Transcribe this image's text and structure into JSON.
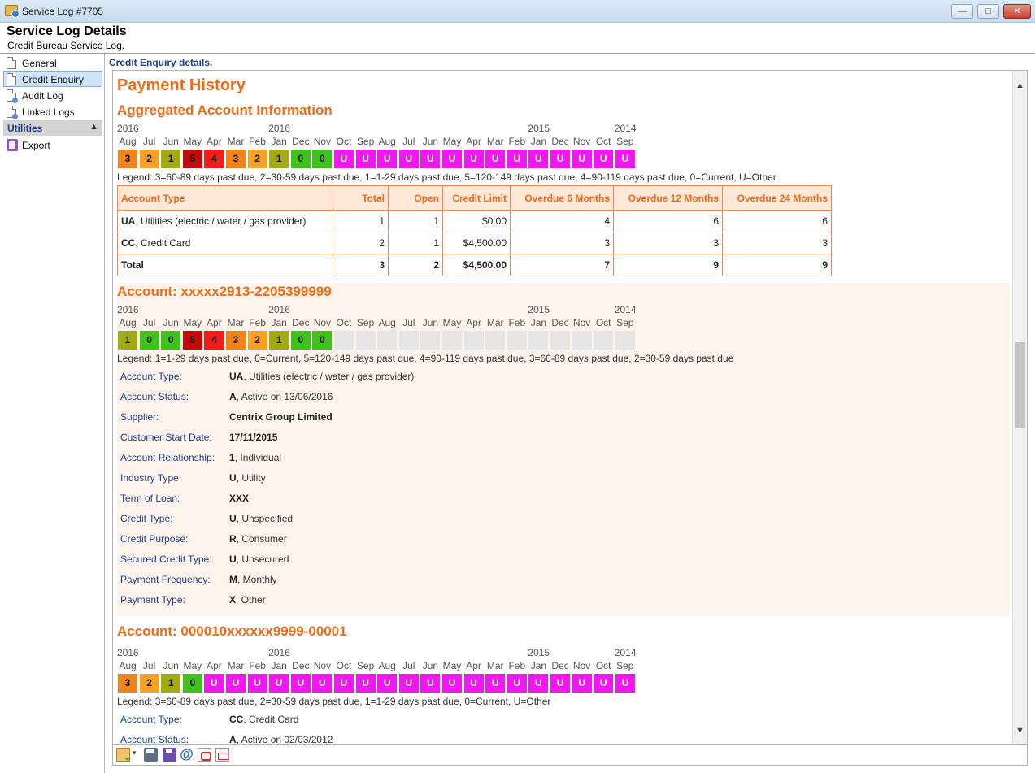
{
  "window": {
    "title": "Service Log #7705",
    "min_label": "—",
    "max_label": "□",
    "close_label": "✕"
  },
  "header": {
    "title": "Service Log Details",
    "subtitle": "Credit Bureau Service Log."
  },
  "sidebar": {
    "items": [
      {
        "label": "General",
        "icon": "document-icon",
        "active": false
      },
      {
        "label": "Credit Enquiry",
        "icon": "document-icon",
        "active": true
      },
      {
        "label": "Audit Log",
        "icon": "document-search-icon",
        "active": false
      },
      {
        "label": "Linked Logs",
        "icon": "document-link-icon",
        "active": false
      }
    ],
    "group": {
      "label": "Utilities",
      "chevron": "▲"
    },
    "group_items": [
      {
        "label": "Export",
        "icon": "export-icon"
      }
    ]
  },
  "section_label": "Credit Enquiry details.",
  "payment_history": {
    "title": "Payment History",
    "aggregated": {
      "title": "Aggregated Account Information",
      "legend": "Legend: 3=60-89 days past due, 2=30-59 days past due, 1=1-29 days past due, 5=120-149 days past due, 4=90-119 days past due, 0=Current, U=Other",
      "cells": [
        "3",
        "2",
        "1",
        "5",
        "4",
        "3",
        "2",
        "1",
        "0",
        "0",
        "U",
        "U",
        "U",
        "U",
        "U",
        "U",
        "U",
        "U",
        "U",
        "U",
        "U",
        "U",
        "U",
        "U"
      ]
    },
    "history_years": [
      {
        "label": "2016",
        "col": 0
      },
      {
        "label": "2016",
        "col": 7
      },
      {
        "label": "2015",
        "col": 19
      },
      {
        "label": "2014",
        "col": 23
      }
    ],
    "history_months": [
      "Aug",
      "Jul",
      "Jun",
      "May",
      "Apr",
      "Mar",
      "Feb",
      "Jan",
      "Dec",
      "Nov",
      "Oct",
      "Sep",
      "Aug",
      "Jul",
      "Jun",
      "May",
      "Apr",
      "Mar",
      "Feb",
      "Jan",
      "Dec",
      "Nov",
      "Oct",
      "Sep"
    ],
    "code_colors": {
      "0": "#3fc21e",
      "1": "#a3ab12",
      "2": "#f5a224",
      "3": "#f0831a",
      "4": "#f51b1b",
      "5": "#c40b0b",
      "U": "#f216f2",
      "": "#e6e6e6"
    },
    "summary_table": {
      "headers": [
        "Account Type",
        "Total",
        "Open",
        "Credit Limit",
        "Overdue 6 Months",
        "Overdue 12 Months",
        "Overdue 24 Months"
      ],
      "rows": [
        {
          "code": "UA",
          "desc": ", Utilities (electric / water / gas provider)",
          "total": "1",
          "open": "1",
          "limit": "$0.00",
          "o6": "4",
          "o12": "6",
          "o24": "6"
        },
        {
          "code": "CC",
          "desc": ", Credit Card",
          "total": "2",
          "open": "1",
          "limit": "$4,500.00",
          "o6": "3",
          "o12": "3",
          "o24": "3"
        }
      ],
      "total_row": {
        "label": "Total",
        "total": "3",
        "open": "2",
        "limit": "$4,500.00",
        "o6": "7",
        "o12": "9",
        "o24": "9"
      }
    },
    "accounts": [
      {
        "title": "Account: xxxxx2913-2205399999",
        "legend": "Legend: 1=1-29 days past due, 0=Current, 5=120-149 days past due, 4=90-119 days past due, 3=60-89 days past due, 2=30-59 days past due",
        "cells": [
          "1",
          "0",
          "0",
          "5",
          "4",
          "3",
          "2",
          "1",
          "0",
          "0",
          "",
          "",
          "",
          "",
          "",
          "",
          "",
          "",
          "",
          "",
          "",
          "",
          "",
          ""
        ],
        "details": [
          {
            "key": "Account Type:",
            "code": "UA",
            "rest": ", Utilities (electric / water / gas provider)"
          },
          {
            "key": "Account Status:",
            "code": "A",
            "rest": ", Active on 13/06/2016"
          },
          {
            "key": "Supplier:",
            "code": "Centrix Group Limited",
            "rest": ""
          },
          {
            "key": "Customer Start Date:",
            "code": "17/11/2015",
            "rest": ""
          },
          {
            "key": "Account Relationship:",
            "code": "1",
            "rest": ", Individual"
          },
          {
            "key": "Industry Type:",
            "code": "U",
            "rest": ", Utility"
          },
          {
            "key": "Term of Loan:",
            "code": "XXX",
            "rest": ""
          },
          {
            "key": "Credit Type:",
            "code": "U",
            "rest": ", Unspecified"
          },
          {
            "key": "Credit Purpose:",
            "code": "R",
            "rest": ", Consumer"
          },
          {
            "key": "Secured Credit Type:",
            "code": "U",
            "rest": ", Unsecured"
          },
          {
            "key": "Payment Frequency:",
            "code": "M",
            "rest": ", Monthly"
          },
          {
            "key": "Payment Type:",
            "code": "X",
            "rest": ", Other"
          }
        ]
      },
      {
        "title": "Account: 000010xxxxxx9999-00001",
        "legend": "Legend: 3=60-89 days past due, 2=30-59 days past due, 1=1-29 days past due, 0=Current, U=Other",
        "cells": [
          "3",
          "2",
          "1",
          "0",
          "U",
          "U",
          "U",
          "U",
          "U",
          "U",
          "U",
          "U",
          "U",
          "U",
          "U",
          "U",
          "U",
          "U",
          "U",
          "U",
          "U",
          "U",
          "U",
          "U"
        ],
        "details": [
          {
            "key": "Account Type:",
            "code": "CC",
            "rest": ", Credit Card"
          },
          {
            "key": "Account Status:",
            "code": "A",
            "rest": ", Active on 02/03/2012"
          }
        ]
      }
    ]
  },
  "toolbar": {
    "buttons": [
      {
        "name": "new-item-icon"
      },
      {
        "name": "print-icon"
      },
      {
        "name": "save-icon"
      },
      {
        "name": "email-icon",
        "glyph": "@"
      },
      {
        "name": "pdf-icon"
      },
      {
        "name": "pdf-email-icon"
      }
    ],
    "dropdown_glyph": "▾"
  }
}
